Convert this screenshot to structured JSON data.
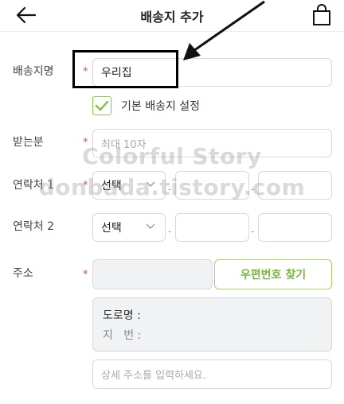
{
  "header": {
    "title": "배송지 추가",
    "back_icon": "arrow-left-icon",
    "bag_icon": "shopping-bag-icon"
  },
  "form": {
    "name_label": "배송지명",
    "name_value": "우리집",
    "default_checkbox_label": "기본 배송지 설정",
    "default_checked": true,
    "recipient_label": "받는분",
    "recipient_placeholder": "최대 10자",
    "phone1_label": "연락처 1",
    "phone2_label": "연락처 2",
    "select_value": "선택",
    "dash": "-",
    "address_label": "주소",
    "zip_button_label": "우편번호 찾기",
    "road_label": "도로명 :",
    "jibun_label": "지   번 :",
    "detail_placeholder": "상세 주소를 입력하세요.",
    "required_mark": "*"
  },
  "watermark": {
    "line1": "Colorful Story",
    "line2": "donbada.tistory.com"
  },
  "colors": {
    "accent_green": "#8bc34a",
    "required_red": "#e74c3c"
  }
}
